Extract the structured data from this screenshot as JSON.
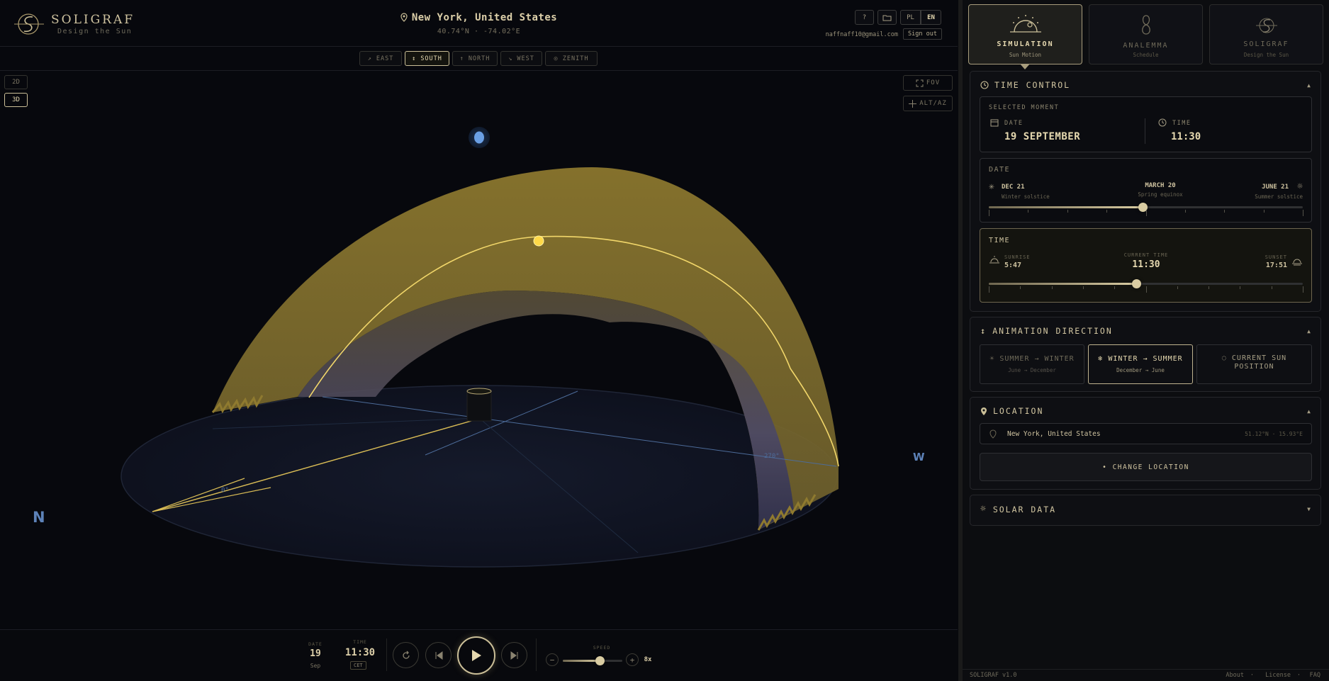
{
  "app": {
    "name": "SOLIGRAF",
    "tagline": "Design the Sun"
  },
  "header": {
    "location": "New York, United States",
    "coords": "40.74°N · -74.02°E",
    "help_label": "?",
    "lang_pl": "PL",
    "lang_en": "EN",
    "email": "naffnaff10@gmail.com",
    "signout_label": "Sign out"
  },
  "directions": [
    {
      "label": "↗ EAST"
    },
    {
      "label": "↕ SOUTH",
      "active": true
    },
    {
      "label": "↑ NORTH"
    },
    {
      "label": "↘ WEST"
    },
    {
      "label": "◎ ZENITH"
    }
  ],
  "view_modes": {
    "mode_2d": "2D",
    "mode_3d": "3D",
    "active": "3D"
  },
  "tools": {
    "fov": "FOV",
    "altaz": "ALT/AZ"
  },
  "scene": {
    "compass_n": "N",
    "compass_w": "W",
    "azimuth_label": "270°",
    "azimuth_label_2": "0°"
  },
  "playback": {
    "date_label": "DATE",
    "day": "19",
    "month": "Sep",
    "time_label": "TIME",
    "time": "11:30",
    "tz": "CET",
    "speed_label": "SPEED",
    "speed_value": "8x",
    "speed_fraction": 0.62
  },
  "sidebar": {
    "tabs": [
      {
        "title": "SIMULATION",
        "subtitle": "Sun Motion",
        "active": true,
        "icon": "sun-horizon-icon"
      },
      {
        "title": "ANALEMMA",
        "subtitle": "Schedule",
        "icon": "analemma-icon"
      },
      {
        "title": "SOLIGRAF",
        "subtitle": "Design the Sun",
        "icon": "soligraf-logo-icon"
      }
    ],
    "time_control": {
      "title": "TIME CONTROL",
      "selected_moment": "SELECTED MOMENT",
      "date_label": "DATE",
      "date_value": "19 SEPTEMBER",
      "time_label": "TIME",
      "time_value": "11:30",
      "date_section": {
        "title": "DATE",
        "left_title": "DEC 21",
        "left_sub": "Winter solstice",
        "mid_title": "MARCH 20",
        "mid_sub": "Spring equinox",
        "right_title": "JUNE 21",
        "right_sub": "Summer solstice",
        "fraction": 0.49
      },
      "time_section": {
        "title": "TIME",
        "sunrise_label": "SUNRISE",
        "sunrise": "5:47",
        "current_label": "CURRENT TIME",
        "current": "11:30",
        "sunset_label": "SUNSET",
        "sunset": "17:51",
        "fraction": 0.47
      }
    },
    "animation": {
      "title": "ANIMATION DIRECTION",
      "options": [
        {
          "title": "☀ SUMMER → WINTER",
          "sub": "June → December"
        },
        {
          "title": "❄ WINTER → SUMMER",
          "sub": "December → June",
          "active": true
        },
        {
          "title": "◌ CURRENT SUN POSITION",
          "line1": "CURRENT SUN",
          "line2": "POSITION"
        }
      ]
    },
    "location": {
      "title": "LOCATION",
      "name": "New York, United States",
      "coords": "51.12°N · 15.93°E",
      "change_label": "• CHANGE LOCATION"
    },
    "solar": {
      "title": "SOLAR DATA"
    }
  },
  "footer": {
    "version": "SOLIGRAF v1.0",
    "about": "About",
    "license": "License",
    "faq": "FAQ"
  },
  "colors": {
    "gold": "#cbbf98",
    "accent_blue": "#5d82b8",
    "bg": "#07080d"
  }
}
